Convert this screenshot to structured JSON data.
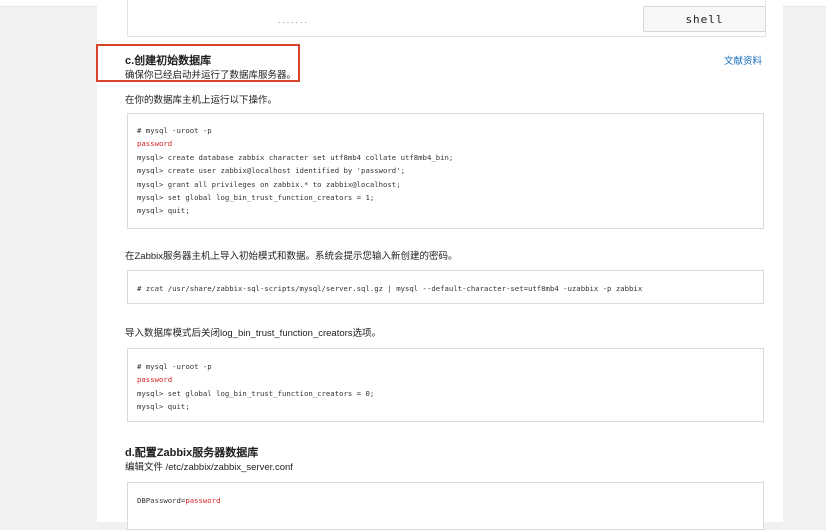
{
  "top_code": {
    "tag": "shell",
    "dots": ".   .          .   .        .          .      ."
  },
  "section_c": {
    "title": "c.创建初始数据库",
    "subtitle": "确保你已经启动并运行了数据库服务器。",
    "docs_link": "文献资料",
    "intro": "在你的数据库主机上运行以下操作。",
    "code1": [
      {
        "text": "# mysql -uroot -p",
        "kind": "normal"
      },
      {
        "text": "password",
        "kind": "password"
      },
      {
        "text": "mysql> create database zabbix character set utf8mb4 collate utf8mb4_bin;",
        "kind": "normal"
      },
      {
        "text": "mysql> create user zabbix@localhost identified by 'password';",
        "kind": "normal"
      },
      {
        "text": "mysql> grant all privileges on zabbix.* to zabbix@localhost;",
        "kind": "normal"
      },
      {
        "text": "mysql> set global log_bin_trust_function_creators = 1;",
        "kind": "normal"
      },
      {
        "text": "mysql> quit;",
        "kind": "normal"
      }
    ],
    "import_text": "在Zabbix服务器主机上导入初始模式和数据。系统会提示您输入新创建的密码。",
    "code2": "# zcat /usr/share/zabbix-sql-scripts/mysql/server.sql.gz | mysql --default-character-set=utf8mb4 -uzabbix -p zabbix",
    "disable_text": "导入数据库模式后关闭log_bin_trust_function_creators选项。",
    "code3": [
      {
        "text": "# mysql -uroot -p",
        "kind": "normal"
      },
      {
        "text": "password",
        "kind": "password"
      },
      {
        "text": "mysql> set global log_bin_trust_function_creators = 0;",
        "kind": "normal"
      },
      {
        "text": "mysql> quit;",
        "kind": "normal"
      }
    ]
  },
  "section_d": {
    "title": "d.配置Zabbix服务器数据库",
    "subtitle": "编辑文件 /etc/zabbix/zabbix_server.conf",
    "code_prefix": "DBPassword=",
    "code_password": "password"
  }
}
